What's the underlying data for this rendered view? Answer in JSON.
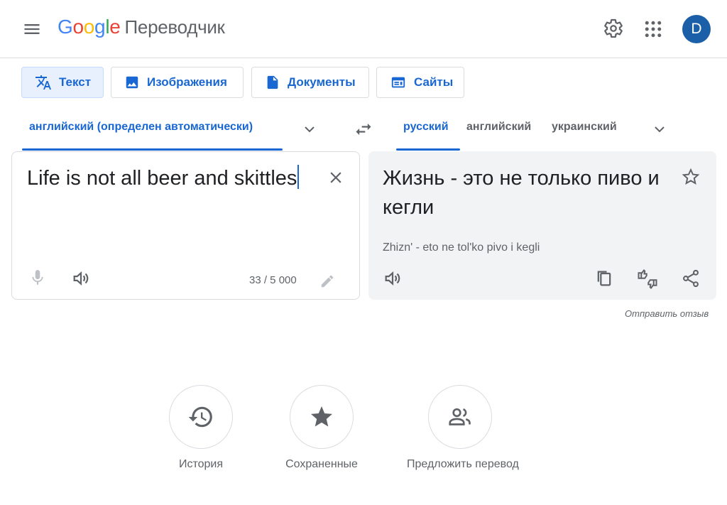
{
  "header": {
    "logo_letters": [
      "G",
      "o",
      "o",
      "g",
      "l",
      "e"
    ],
    "product_name": "Переводчик",
    "avatar_letter": "D"
  },
  "modes": [
    {
      "label": "Текст",
      "icon": "translate-icon",
      "active": true
    },
    {
      "label": "Изображения",
      "icon": "image-icon",
      "active": false
    },
    {
      "label": "Документы",
      "icon": "document-icon",
      "active": false
    },
    {
      "label": "Сайты",
      "icon": "website-icon",
      "active": false
    }
  ],
  "source_lang": {
    "label": "английский (определен автоматически)"
  },
  "target_langs": [
    {
      "label": "русский",
      "active": true
    },
    {
      "label": "английский",
      "active": false
    },
    {
      "label": "украинский",
      "active": false
    }
  ],
  "source": {
    "text": "Life is not all beer and skittles",
    "char_count": "33 / 5 000"
  },
  "target": {
    "text": "Жизнь - это не только пиво и кегли",
    "transliteration": "Zhizn' - eto ne tol'ko pivo i kegli"
  },
  "feedback_label": "Отправить отзыв",
  "bottom": [
    {
      "label": "История",
      "icon": "history-icon"
    },
    {
      "label": "Сохраненные",
      "icon": "star-icon"
    },
    {
      "label": "Предложить перевод",
      "icon": "people-icon"
    }
  ],
  "colors": {
    "accent": "#1967d2",
    "avatar": "#1a5fa8",
    "target_bg": "#f1f3f4"
  }
}
